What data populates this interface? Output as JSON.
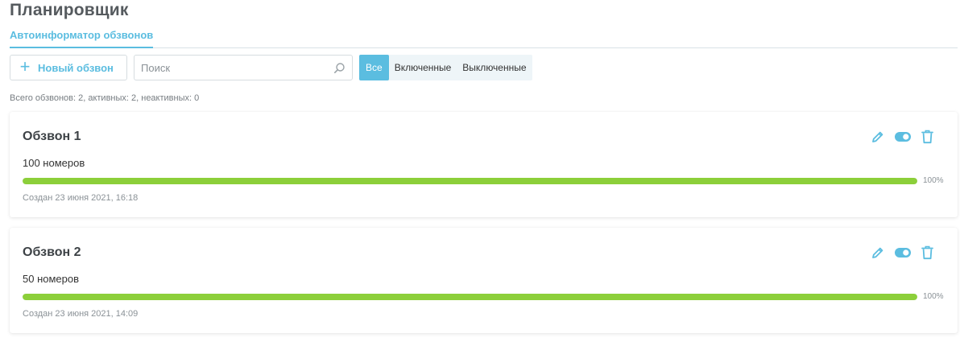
{
  "page": {
    "title": "Планировщик"
  },
  "tabs": [
    {
      "label": "Автоинформатор обзвонов",
      "active": true
    }
  ],
  "toolbar": {
    "new_button_label": "Новый обзвон",
    "search": {
      "placeholder": "Поиск",
      "value": ""
    },
    "filters": [
      {
        "label": "Все",
        "active": true
      },
      {
        "label": "Включенные",
        "active": false
      },
      {
        "label": "Выключенные",
        "active": false
      }
    ]
  },
  "summary": "Всего обзвонов: 2, активных: 2, неактивных: 0",
  "campaigns": [
    {
      "name": "Обзвон 1",
      "count": "100 номеров",
      "progress": 100,
      "progress_label": "100%",
      "created": "Создан 23 июня 2021, 16:18",
      "enabled": true
    },
    {
      "name": "Обзвон 2",
      "count": "50 номеров",
      "progress": 100,
      "progress_label": "100%",
      "created": "Создан 23 июня 2021, 14:09",
      "enabled": true
    }
  ],
  "colors": {
    "accent": "#5bbde0",
    "progress": "#8ccf3a"
  },
  "icons": {
    "new": "plus-icon",
    "search": "search-icon",
    "edit": "pencil-icon",
    "toggle": "toggle-icon",
    "delete": "trash-icon"
  }
}
